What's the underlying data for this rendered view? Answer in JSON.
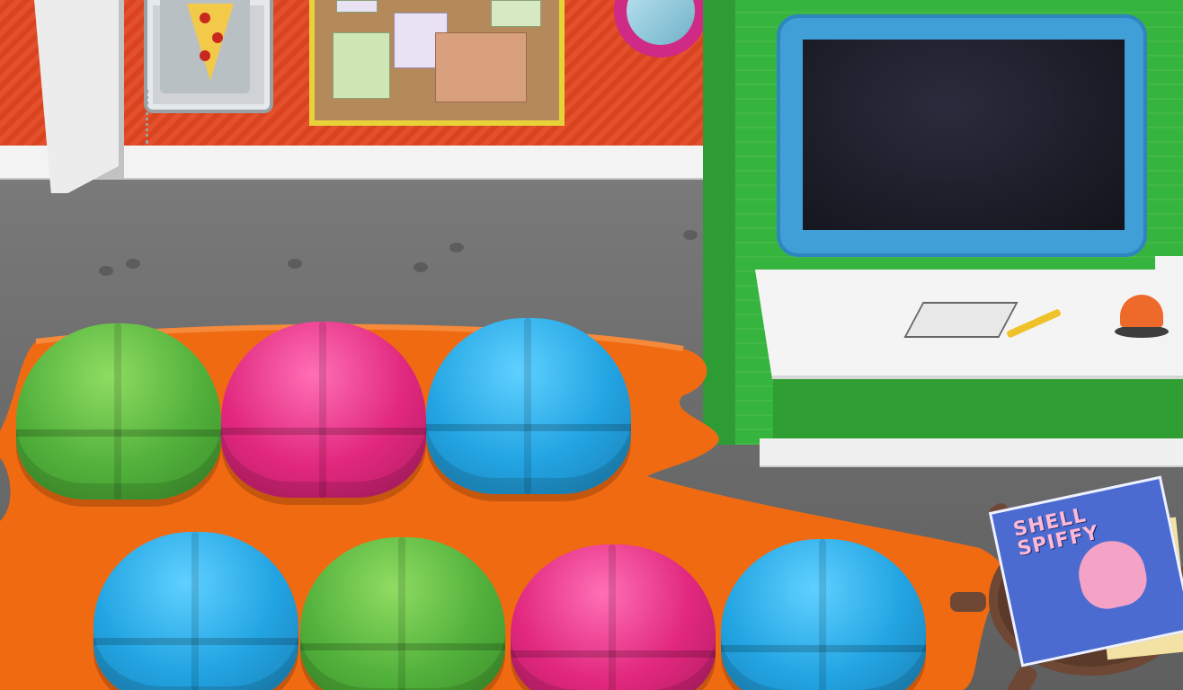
{
  "scene": {
    "magazine": {
      "title_line1": "SHELL",
      "title_line2": "SPIFFY"
    },
    "beanbags": [
      {
        "color": "green"
      },
      {
        "color": "pink"
      },
      {
        "color": "blue"
      },
      {
        "color": "blue"
      },
      {
        "color": "green"
      },
      {
        "color": "pink"
      },
      {
        "color": "blue"
      }
    ]
  },
  "colors": {
    "wall": "#e4502b",
    "booth": "#36b53e",
    "rug": "#f06a12",
    "tv_frame": "#3f9fd6",
    "beanbag_green": "#52b13b",
    "beanbag_pink": "#e1287e",
    "beanbag_blue": "#22a4e2"
  }
}
